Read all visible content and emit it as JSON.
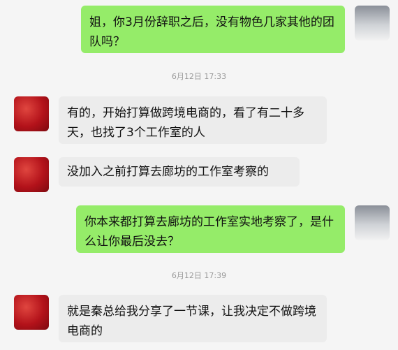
{
  "messages": [
    {
      "side": "right",
      "sender": "me",
      "text": "姐，你3月份辞职之后，没有物色几家其他的团队吗？"
    },
    {
      "type": "timestamp",
      "text": "6月12日 17:33"
    },
    {
      "side": "left",
      "sender": "other",
      "text": "有的，开始打算做跨境电商的，看了有二十多天，也找了3个工作室的人"
    },
    {
      "side": "left",
      "sender": "other",
      "text": "没加入之前打算去廊坊的工作室考察的"
    },
    {
      "side": "right",
      "sender": "me",
      "text": "你本来都打算去廊坊的工作室实地考察了，是什么让你最后没去？"
    },
    {
      "type": "timestamp",
      "text": "6月12日 17:39"
    },
    {
      "side": "left",
      "sender": "other",
      "text": "就是秦总给我分享了一节课，让我决定不做跨境电商的"
    }
  ],
  "colors": {
    "background": "#f5f5f5",
    "sent_bubble": "#95ec69",
    "received_bubble": "#ececec",
    "timestamp_text": "#9a9a9a"
  },
  "icons": {
    "avatar_self": "user-avatar-icon",
    "avatar_other": "contact-avatar-icon"
  }
}
